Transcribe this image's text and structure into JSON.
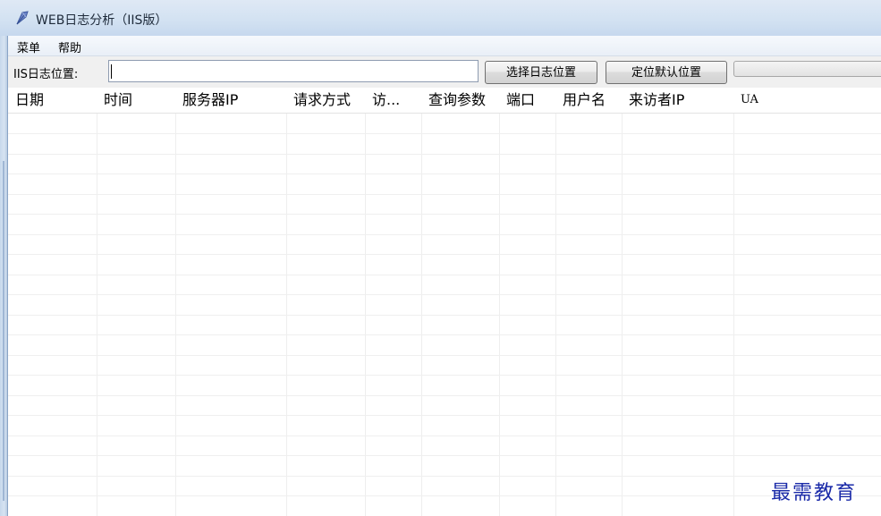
{
  "window": {
    "title": "WEB日志分析（IIS版）",
    "app_icon": "feather-app-icon"
  },
  "menubar": {
    "items": [
      {
        "label": "菜单"
      },
      {
        "label": "帮助"
      }
    ]
  },
  "toolbar": {
    "path_label": "IIS日志位置:",
    "path_value": "",
    "select_button": "选择日志位置",
    "default_button": "定位默认位置"
  },
  "table": {
    "columns": [
      {
        "label": "日期"
      },
      {
        "label": "时间"
      },
      {
        "label": "服务器IP"
      },
      {
        "label": "请求方式"
      },
      {
        "label": "访..."
      },
      {
        "label": "查询参数"
      },
      {
        "label": "端口"
      },
      {
        "label": "用户名"
      },
      {
        "label": "来访者IP"
      },
      {
        "label": "UA"
      }
    ],
    "rows": []
  },
  "watermark": "最需教育",
  "colors": {
    "title_gradient_top": "#dfe9f5",
    "watermark": "#1a2aa8",
    "grid_line": "#eeeeee"
  }
}
